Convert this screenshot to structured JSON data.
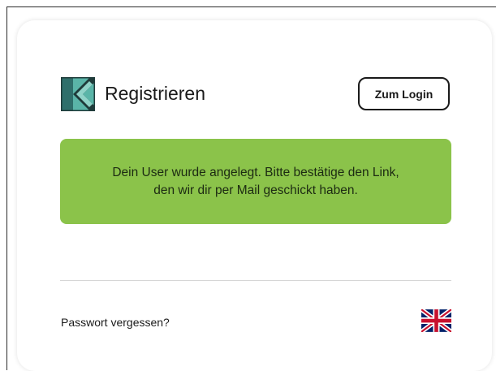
{
  "header": {
    "title": "Registrieren",
    "login_label": "Zum Login",
    "logo_icon": "k-logo-icon"
  },
  "alert": {
    "line1": "Dein User wurde angelegt. Bitte bestätige den Link,",
    "line2": "den wir dir per Mail geschickt haben.",
    "color": "#8bc34a"
  },
  "footer": {
    "forgot_label": "Passwort vergessen?",
    "language_icon": "uk-flag-icon"
  }
}
